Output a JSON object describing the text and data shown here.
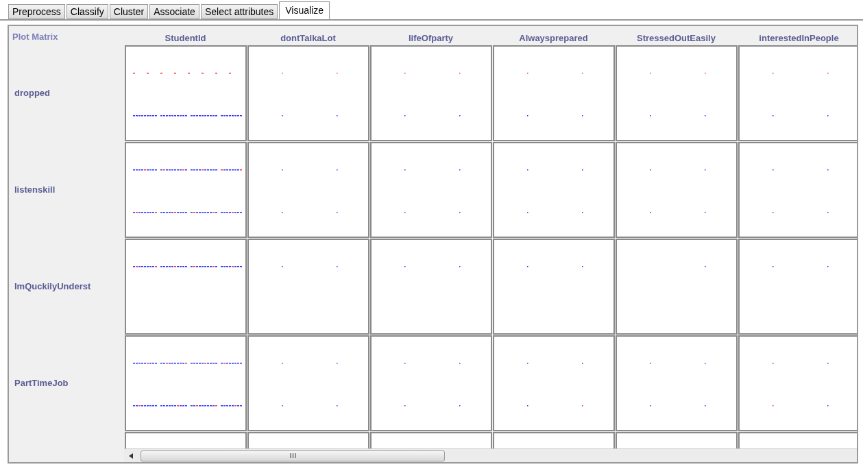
{
  "tabs": [
    {
      "label": "Preprocess",
      "selected": false
    },
    {
      "label": "Classify",
      "selected": false
    },
    {
      "label": "Cluster",
      "selected": false
    },
    {
      "label": "Associate",
      "selected": false
    },
    {
      "label": "Select attributes",
      "selected": false
    },
    {
      "label": "Visualize",
      "selected": true
    }
  ],
  "panel": {
    "title": "Plot Matrix",
    "columns": [
      "StudentId",
      "dontTalkaLot",
      "lifeOfparty",
      "Alwaysprepared",
      "StressedOutEasily",
      "interestedInPeople"
    ],
    "rows": [
      "dropped",
      "listenskill",
      "ImQuckilyUnderst",
      "PartTimeJob"
    ]
  }
}
